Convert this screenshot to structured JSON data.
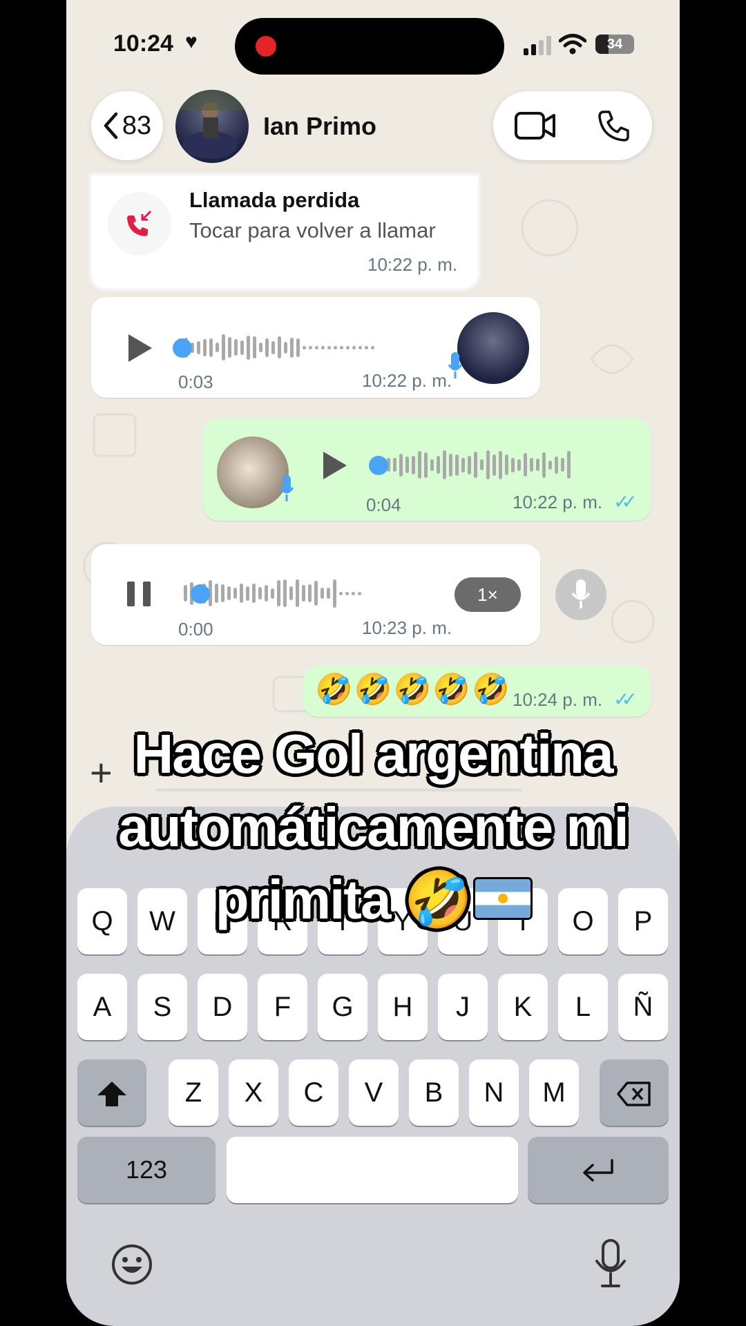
{
  "status_bar": {
    "time": "10:24",
    "heart": "♥",
    "battery": "34"
  },
  "header": {
    "back_count": "83",
    "contact_name": "Ian Primo"
  },
  "messages": {
    "missed_call": {
      "title": "Llamada perdida",
      "subtitle": "Tocar para volver a llamar",
      "time": "10:22 p. m."
    },
    "voice1": {
      "duration": "0:03",
      "time": "10:22 p. m."
    },
    "voice2": {
      "duration": "0:04",
      "time": "10:22 p. m."
    },
    "voice3": {
      "duration": "0:00",
      "time": "10:23 p. m.",
      "speed": "1×"
    },
    "emoji_msg": {
      "text": "🤣🤣🤣🤣🤣",
      "time": "10:24 p. m."
    }
  },
  "input_bar": {
    "plus": "+"
  },
  "keyboard": {
    "row1": [
      "Q",
      "W",
      "E",
      "R",
      "T",
      "Y",
      "U",
      "I",
      "O",
      "P"
    ],
    "row2": [
      "A",
      "S",
      "D",
      "F",
      "G",
      "H",
      "J",
      "K",
      "L",
      "Ñ"
    ],
    "row3": [
      "Z",
      "X",
      "C",
      "V",
      "B",
      "N",
      "M"
    ],
    "numbers_label": "123"
  },
  "caption": {
    "line1": "Hace Gol argentina",
    "line2": "automáticamente mi",
    "line3": "primita 🤣"
  }
}
